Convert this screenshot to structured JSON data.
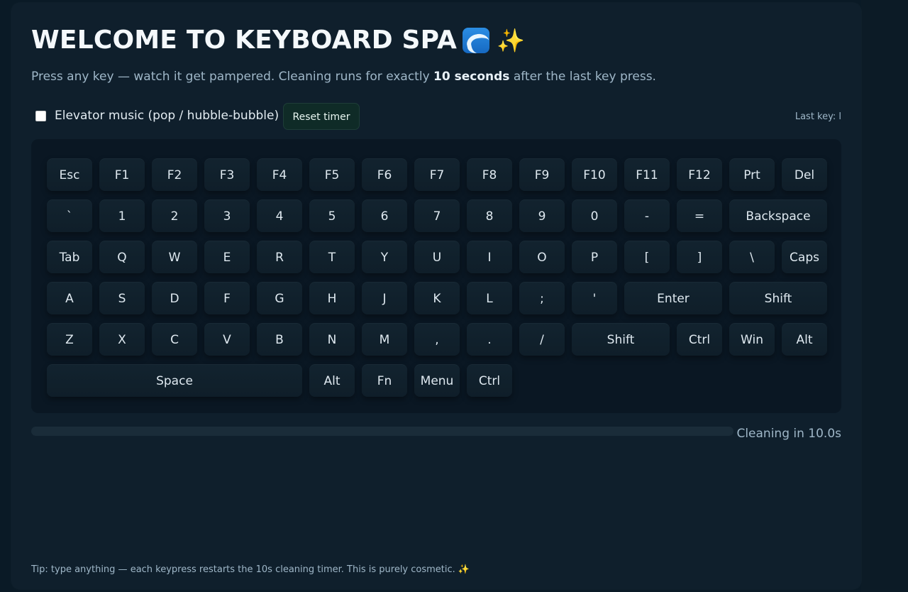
{
  "title": "WELCOME TO KEYBOARD SPA",
  "title_icons": [
    "wave-icon",
    "sparkle-icon"
  ],
  "subtitle": {
    "before": "Press any key — watch it get pampered. Cleaning runs for exactly ",
    "bold": "10 seconds",
    "after": " after the last key press."
  },
  "controls": {
    "music_label": "Elevator music (pop / hubble-bubble)",
    "music_checked": false,
    "reset_label": "Reset timer",
    "last_key_label": "Last key: l"
  },
  "keyboard": {
    "rows": [
      [
        "Esc",
        "F1",
        "F2",
        "F3",
        "F4",
        "F5",
        "F6",
        "F7",
        "F8",
        "F9",
        "F10",
        "F11",
        "F12",
        "Prt",
        "Del"
      ],
      [
        "`",
        "1",
        "2",
        "3",
        "4",
        "5",
        "6",
        "7",
        "8",
        "9",
        "0",
        "-",
        "=",
        "Backspace"
      ],
      [
        "Tab",
        "Q",
        "W",
        "E",
        "R",
        "T",
        "Y",
        "U",
        "I",
        "O",
        "P",
        "[",
        "]",
        "\\",
        "Caps"
      ],
      [
        "A",
        "S",
        "D",
        "F",
        "G",
        "H",
        "J",
        "K",
        "L",
        ";",
        "'",
        "Enter",
        "Shift"
      ],
      [
        "Z",
        "X",
        "C",
        "V",
        "B",
        "N",
        "M",
        ",",
        ".",
        "/",
        "Shift",
        "Ctrl",
        "Win",
        "Alt"
      ],
      [
        "Space",
        "Alt",
        "Fn",
        "Menu",
        "Ctrl"
      ]
    ]
  },
  "progress": {
    "fraction": 0,
    "label": "Cleaning in 10.0s"
  },
  "tip": "Tip: type anything — each keypress restarts the 10s cleaning timer. This is purely cosmetic. ✨",
  "colors": {
    "background": "#0a1a26",
    "panel": "#0f1f2c",
    "key": "#12232f",
    "text": "#dce7ef",
    "muted_text": "#9fb7c8",
    "reset_button": "#0f2b27",
    "sparkle": "#ffcf3d",
    "wave": "#2b8ee4"
  }
}
